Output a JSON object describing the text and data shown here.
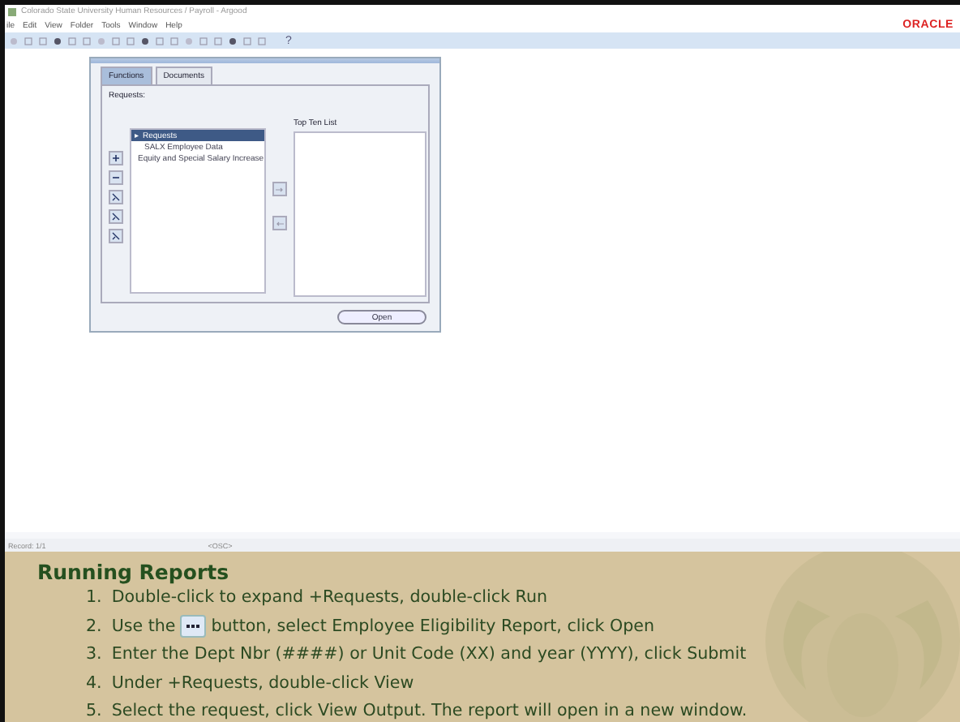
{
  "app": {
    "title": "Colorado State University Human Resources / Payroll - Argood",
    "menu": [
      "ile",
      "Edit",
      "View",
      "Folder",
      "Tools",
      "Window",
      "Help"
    ],
    "help_glyph": "?",
    "brand": "ORACLE"
  },
  "dialog": {
    "tabs": [
      {
        "label": "Functions",
        "selected": true
      },
      {
        "label": "Documents",
        "selected": false
      }
    ],
    "section": "Requests:",
    "tree": [
      {
        "label": "Requests",
        "glyph": "▸",
        "selected": true
      },
      {
        "label": "SALX Employee Data",
        "selected": false
      },
      {
        "label": "Equity and Special Salary Increase",
        "selected": false
      }
    ],
    "top_ten_label": "Top Ten List",
    "open_button": "Open"
  },
  "status_bar": {
    "record": "Record: 1/1",
    "mode": "<OSC>"
  },
  "slide": {
    "title": "Running Reports",
    "steps": [
      {
        "number": "1.",
        "kind": "plain",
        "text": "Double-click to expand +Requests, double-click Run"
      },
      {
        "number": "2.",
        "kind": "with-button",
        "before": "Use the",
        "text": "button, select Employee Eligibility Report, click Open"
      },
      {
        "number": "3.",
        "kind": "plain",
        "text": "Enter the Dept Nbr (####) or Unit Code (XX) and year (YYYY), click Submit"
      },
      {
        "number": "4.",
        "kind": "plain",
        "text": "Under +Requests, double-click View"
      },
      {
        "number": "5.",
        "kind": "plain",
        "text": "Select the request, click View Output. The report will open in a new window."
      }
    ]
  }
}
